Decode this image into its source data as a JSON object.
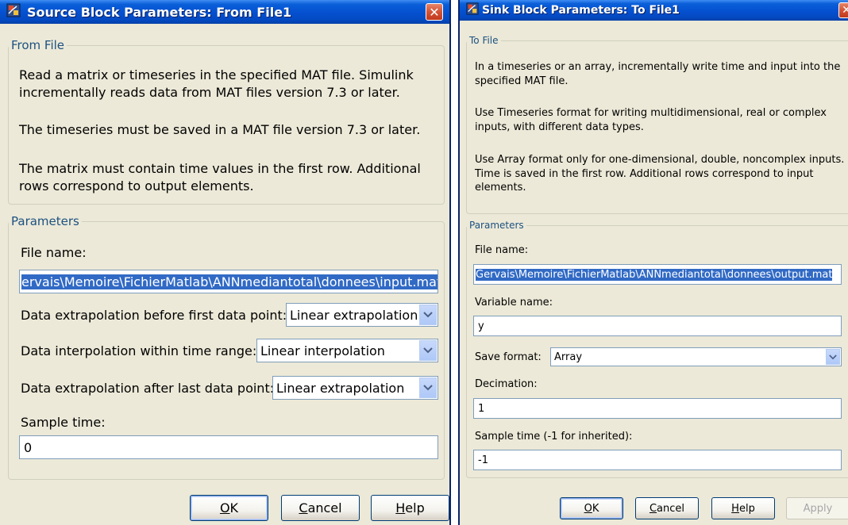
{
  "source_dialog": {
    "title": "Source Block Parameters: From File1",
    "group_title": "From File",
    "description": [
      "Read a matrix or timeseries in the specified MAT file. Simulink incrementally reads data from MAT files version 7.3 or later.",
      "The timeseries must be saved in a MAT file version 7.3 or later.",
      "The matrix must contain time values in the first row. Additional rows correspond to output elements."
    ],
    "params_title": "Parameters",
    "file_name_label": "File name:",
    "file_name_value": "ervais\\Memoire\\FichierMatlab\\ANNmediantotal\\donnees\\input.mat",
    "extrap_before_label": "Data extrapolation before first data point:",
    "extrap_before_value": "Linear extrapolation",
    "interp_label": "Data interpolation within time range:",
    "interp_value": "Linear interpolation",
    "extrap_after_label": "Data extrapolation after last data point:",
    "extrap_after_value": "Linear extrapolation",
    "sample_time_label": "Sample time:",
    "sample_time_value": "0",
    "buttons": {
      "ok": {
        "mnemonic": "O",
        "rest": "K"
      },
      "cancel": {
        "mnemonic": "C",
        "rest": "ancel"
      },
      "help": {
        "mnemonic": "H",
        "rest": "elp"
      }
    }
  },
  "sink_dialog": {
    "title": "Sink Block Parameters: To File1",
    "group_title": "To File",
    "description": [
      "In a timeseries or an array, incrementally write time and input into the specified MAT file.",
      "Use Timeseries format for writing multidimensional, real or complex inputs, with different data types.",
      "Use Array format only for one-dimensional, double, noncomplex inputs. Time is saved in the first row.  Additional rows correspond to input elements."
    ],
    "params_title": "Parameters",
    "file_name_label": "File name:",
    "file_name_value": "Gervais\\Memoire\\FichierMatlab\\ANNmediantotal\\donnees\\output.mat",
    "variable_name_label": "Variable name:",
    "variable_name_value": "y",
    "save_format_label": "Save format:",
    "save_format_value": "Array",
    "decimation_label": "Decimation:",
    "decimation_value": "1",
    "sample_time_label": "Sample time (-1 for inherited):",
    "sample_time_value": "-1",
    "buttons": {
      "ok": {
        "mnemonic": "O",
        "rest": "K"
      },
      "cancel": {
        "mnemonic": "C",
        "rest": "ancel"
      },
      "help": {
        "mnemonic": "H",
        "rest": "elp"
      },
      "apply": "Apply"
    }
  },
  "colors": {
    "title_bar": "#0550d0",
    "dialog_bg": "#ece9d8",
    "group_legend": "#1c5180",
    "selection": "#316ac5",
    "close_button": "#d45336"
  }
}
